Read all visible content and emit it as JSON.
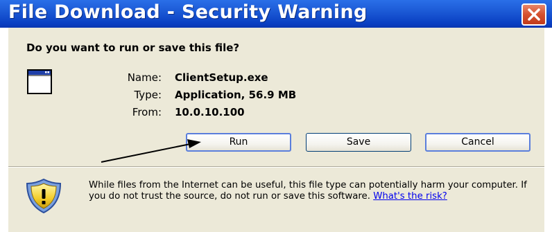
{
  "dialog": {
    "title": "File Download - Security Warning",
    "close_icon": "close-x-icon"
  },
  "question": "Do you want to run or save this file?",
  "file": {
    "icon": "application-window-icon",
    "name_label": "Name:",
    "name_value": "ClientSetup.exe",
    "type_label": "Type:",
    "type_value": "Application, 56.9 MB",
    "from_label": "From:",
    "from_value": "10.0.10.100"
  },
  "buttons": {
    "run": "Run",
    "save": "Save",
    "cancel": "Cancel"
  },
  "warning": {
    "icon": "security-shield-icon",
    "text": "While files from the Internet can be useful, this file type can potentially harm your computer. If you do not trust the source, do not run or save this software.",
    "link": "What's the risk?"
  },
  "annotation": {
    "icon": "pointer-arrow"
  },
  "colors": {
    "titlebar": "#1c5ad6",
    "panel": "#ece9d8",
    "close_button": "#d5512f",
    "link": "#0000ee"
  }
}
